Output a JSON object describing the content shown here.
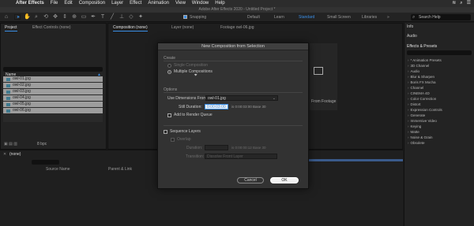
{
  "menubar": {
    "app": "After Effects",
    "items": [
      "File",
      "Edit",
      "Composition",
      "Layer",
      "Effect",
      "Animation",
      "View",
      "Window",
      "Help"
    ]
  },
  "app_title": "Adobe After Effects 2020 - Untitled Project *",
  "toolbar": {
    "snapping_label": "Snapping",
    "workspaces": [
      "Default",
      "Learn",
      "Standard",
      "Small Screen",
      "Libraries"
    ],
    "search_help_placeholder": "Search Help"
  },
  "project_panel": {
    "tabs": [
      "Project",
      "Effect Controls (none)"
    ],
    "list_header": "Name",
    "items": [
      "owl-01.jpg",
      "owl-02.jpg",
      "owl-03.jpg",
      "owl-04.jpg",
      "owl-05.jpg",
      "owl-06.jpg"
    ],
    "footer_bpc": "8 bpc"
  },
  "viewer": {
    "tabs": [
      "Composition (none)",
      "Layer (none)",
      "Footage owl-06.jpg"
    ],
    "placeholder_fragments": [
      "New Composition",
      "From Footage"
    ]
  },
  "dialog": {
    "title": "New Composition from Selection",
    "create_label": "Create",
    "single_label": "Single Composition",
    "multiple_label": "Multiple Compositions",
    "options_label": "Options",
    "use_dimensions_label": "Use Dimensions From:",
    "use_dimensions_value": "owl-01.jpg",
    "still_duration_label": "Still Duration:",
    "still_duration_value": "0:00:03:00",
    "still_duration_readout": "is 0:00:03:00  Base 30",
    "add_render_queue_label": "Add to Render Queue",
    "sequence_layers_label": "Sequence Layers",
    "overlap_label": "Overlap",
    "duration_label": "Duration:",
    "duration_readout": "is 0:00:00:12  Base 30",
    "transition_label": "Transition:",
    "transition_value": "Dissolve Front Layer",
    "cancel_label": "Cancel",
    "ok_label": "OK",
    "accent_color": "#3a8ee6"
  },
  "right_panel": {
    "info_label": "Info",
    "audio_label": "Audio",
    "effects_label": "Effects & Presets",
    "items": [
      "* Animation Presets",
      "3D Channel",
      "Audio",
      "Blur & Sharpen",
      "Boris FX Mocha",
      "Channel",
      "CINEMA 4D",
      "Color Correction",
      "Distort",
      "Expression Controls",
      "Generate",
      "Immersive Video",
      "Keying",
      "Matte",
      "Noise & Grain",
      "Obsolete"
    ]
  },
  "timeline": {
    "tab": "(none)",
    "col_source": "Source Name",
    "col_parent": "Parent & Link"
  }
}
